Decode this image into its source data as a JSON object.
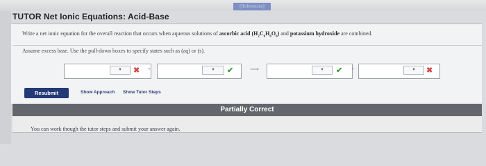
{
  "window": {
    "references_button": "[References]",
    "title": "TUTOR  Net Ionic Equations: Acid-Base"
  },
  "question": {
    "prefix": "Write a net ionic equation for the overall reaction that occurs when aqueous solutions of ",
    "reactant1": "ascorbic acid",
    "formula_open": " (H",
    "sub1": "2",
    "c": "C",
    "sub2": "6",
    "h": "H",
    "sub3": "6",
    "o": "O",
    "sub4": "6",
    "formula_close": ")",
    "middle": " and ",
    "reactant2": "potassium hydroxide",
    "suffix": " are combined.",
    "assume": "Assume excess base. Use the pull-down boxes to specify states such as (aq) or (s)."
  },
  "equation": {
    "plus": "+",
    "arrow": "⟶",
    "dropdown_glyph": "▾",
    "terms": [
      {
        "value": "",
        "state": "",
        "mark": "incorrect"
      },
      {
        "value": "",
        "state": "",
        "mark": "correct"
      },
      {
        "value": "",
        "state": "",
        "mark": "correct"
      },
      {
        "value": "",
        "state": "",
        "mark": "incorrect"
      }
    ],
    "mark_glyphs": {
      "correct": "✔",
      "incorrect": "✖"
    },
    "colors": {
      "correct": "#3d9a3d",
      "incorrect": "#d24a4a"
    }
  },
  "actions": {
    "resubmit": "Resubmit",
    "show_approach": "Show Approach",
    "show_tutor_steps": "Show Tutor Steps"
  },
  "status": {
    "banner": "Partially Correct",
    "message": "You can work though the tutor steps and submit your answer again."
  },
  "colors": {
    "accent": "#223a75",
    "status_bar": "#63676d"
  }
}
